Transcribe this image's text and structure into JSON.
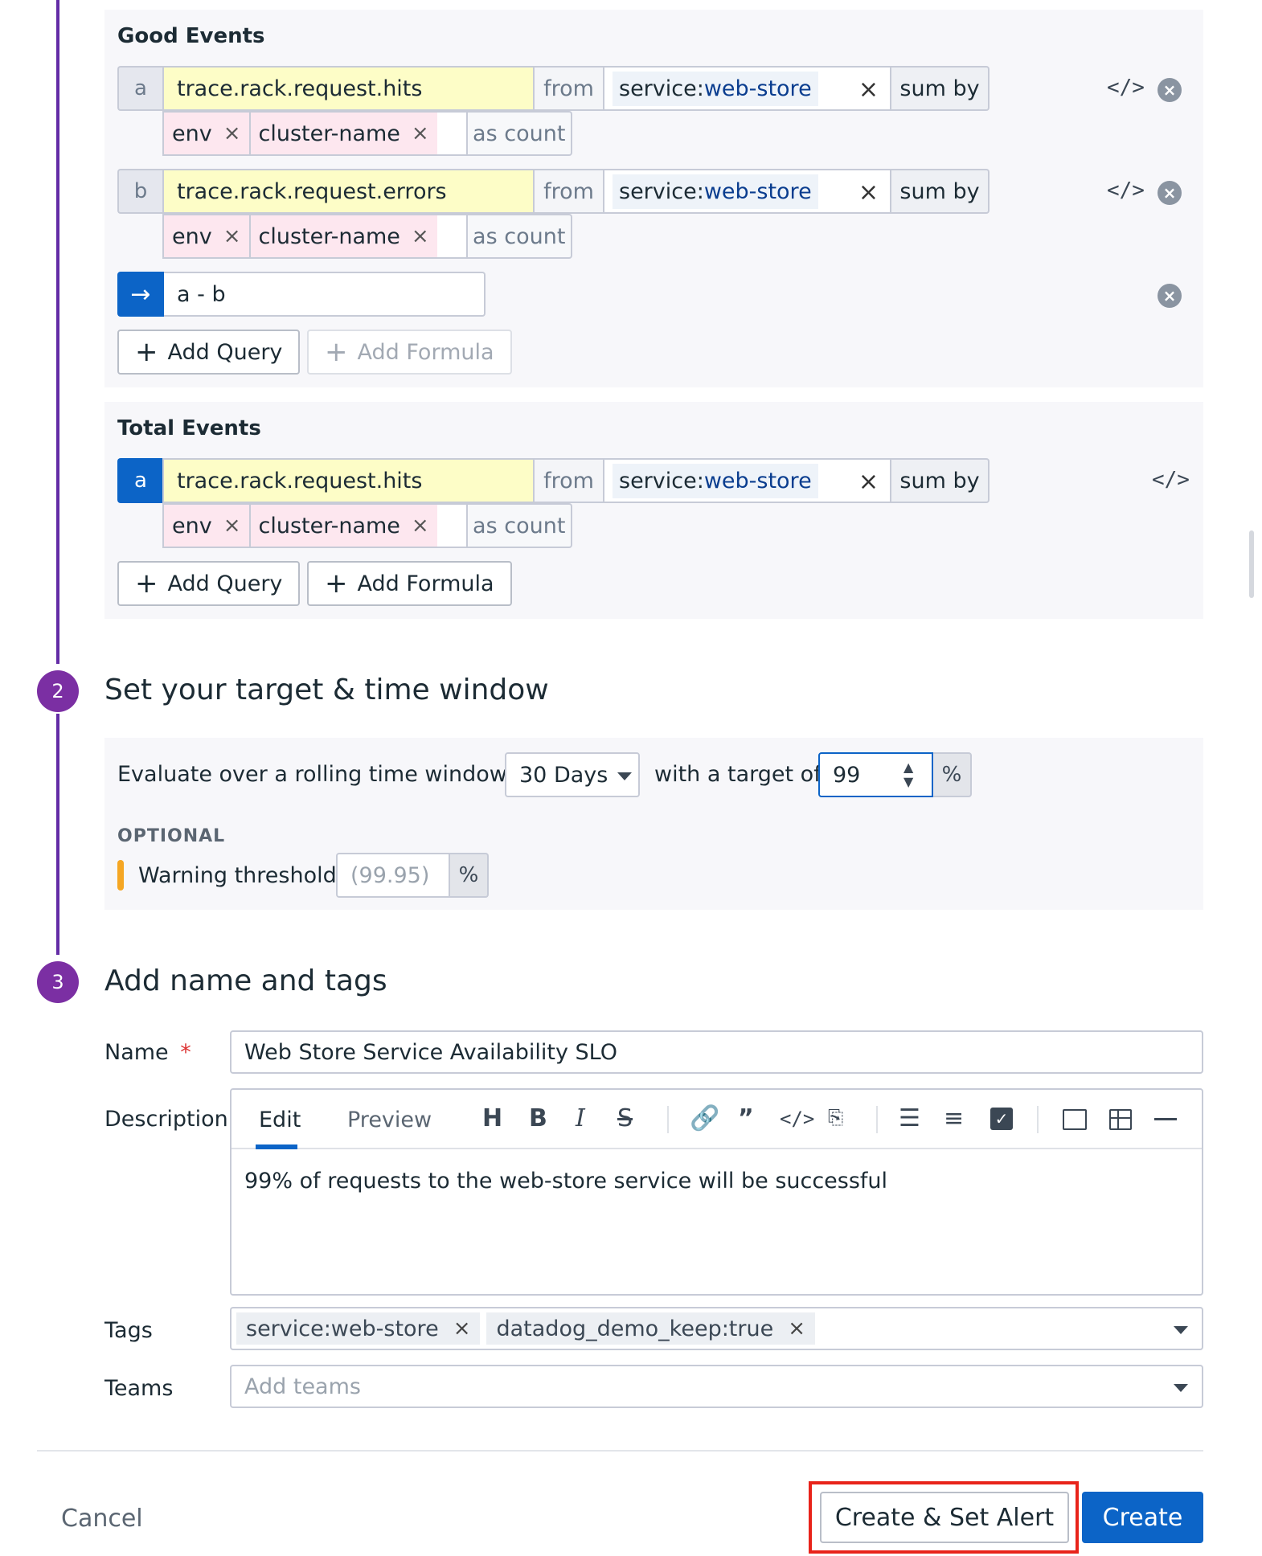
{
  "good_events": {
    "title": "Good Events",
    "queries": [
      {
        "letter": "a",
        "metric": "trace.rack.request.hits",
        "from": "from",
        "scope_key": "service:",
        "scope_val": "web-store",
        "agg": "sum by",
        "groups": [
          "env",
          "cluster-name"
        ],
        "as": "as count"
      },
      {
        "letter": "b",
        "metric": "trace.rack.request.errors",
        "from": "from",
        "scope_key": "service:",
        "scope_val": "web-store",
        "agg": "sum by",
        "groups": [
          "env",
          "cluster-name"
        ],
        "as": "as count"
      }
    ],
    "formula": "a - b",
    "add_query": "Add Query",
    "add_formula": "Add Formula"
  },
  "total_events": {
    "title": "Total Events",
    "queries": [
      {
        "letter": "a",
        "metric": "trace.rack.request.hits",
        "from": "from",
        "scope_key": "service:",
        "scope_val": "web-store",
        "agg": "sum by",
        "groups": [
          "env",
          "cluster-name"
        ],
        "as": "as count"
      }
    ],
    "add_query": "Add Query",
    "add_formula": "Add Formula"
  },
  "icons": {
    "code": "</>",
    "remove": "×",
    "close": "×",
    "arrow": "→",
    "plus": "+"
  },
  "step2": {
    "number": "2",
    "title": "Set your target & time window",
    "evaluate_label": "Evaluate over a rolling time window of",
    "window_value": "30 Days",
    "target_label": "with a target of",
    "target_value": "99",
    "percent": "%",
    "optional_label": "OPTIONAL",
    "warning_label": "Warning threshold",
    "warning_placeholder": "(99.95)",
    "warning_color": "#f5a623"
  },
  "step3": {
    "number": "3",
    "title": "Add name and tags",
    "name_label": "Name",
    "required_mark": "*",
    "name_value": "Web Store Service Availability SLO",
    "description_label": "Description",
    "tab_edit": "Edit",
    "tab_preview": "Preview",
    "description_value": "99% of requests to the web-store service will be successful",
    "tags_label": "Tags",
    "tags": [
      "service:web-store",
      "datadog_demo_keep:true"
    ],
    "teams_label": "Teams",
    "teams_placeholder": "Add teams"
  },
  "footer": {
    "cancel": "Cancel",
    "create_set_alert": "Create & Set Alert",
    "create": "Create"
  },
  "colors": {
    "accent": "#0c64c7",
    "step": "#7b2fa3",
    "highlight_box": "#e8231a"
  }
}
